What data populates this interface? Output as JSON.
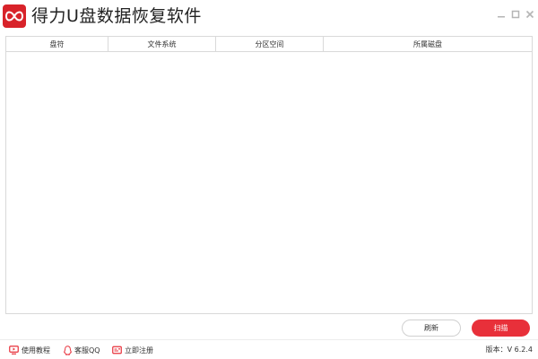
{
  "window": {
    "title": "得力U盘数据恢复软件",
    "accent_color": "#e8303a",
    "logo_icon": "infinity-logo-icon"
  },
  "window_controls": {
    "minimize_icon": "minimize-icon",
    "maximize_icon": "maximize-icon",
    "close_icon": "close-icon"
  },
  "table": {
    "columns": [
      "盘符",
      "文件系统",
      "分区空间",
      "所属磁盘"
    ],
    "rows": []
  },
  "actions": {
    "refresh_label": "刷新",
    "scan_label": "扫描"
  },
  "footer": {
    "tutorial_label": "使用教程",
    "tutorial_icon": "monitor-icon",
    "qq_label": "客服QQ",
    "qq_icon": "qq-penguin-icon",
    "register_label": "立即注册",
    "register_icon": "register-card-icon",
    "version_text": "版本：V 6.2.4"
  }
}
